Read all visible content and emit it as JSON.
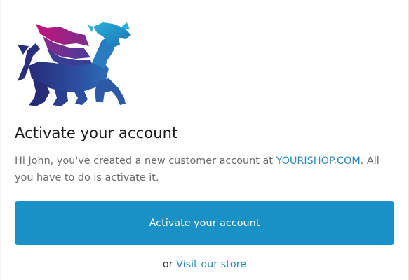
{
  "logo": {
    "icon": "dragon-logo",
    "colors": {
      "wing_top": "#c2127a",
      "wing_mid": "#7a2f8c",
      "head": "#1f8fc4",
      "body_dark": "#2b2f7f",
      "body_mid": "#2d4ea0"
    }
  },
  "heading": "Activate your account",
  "message": {
    "before_link": "Hi John, you've created a new customer account at ",
    "shop_link": "YOURISHOP.COM",
    "after_link": ". All you have to do is activate it."
  },
  "cta": {
    "label": "Activate your account",
    "color": "#1a91c6"
  },
  "footer": {
    "prefix": "or ",
    "store_link": "Visit our store"
  },
  "colors": {
    "link": "#2a8bc0",
    "body_text": "#6b6b6b"
  }
}
